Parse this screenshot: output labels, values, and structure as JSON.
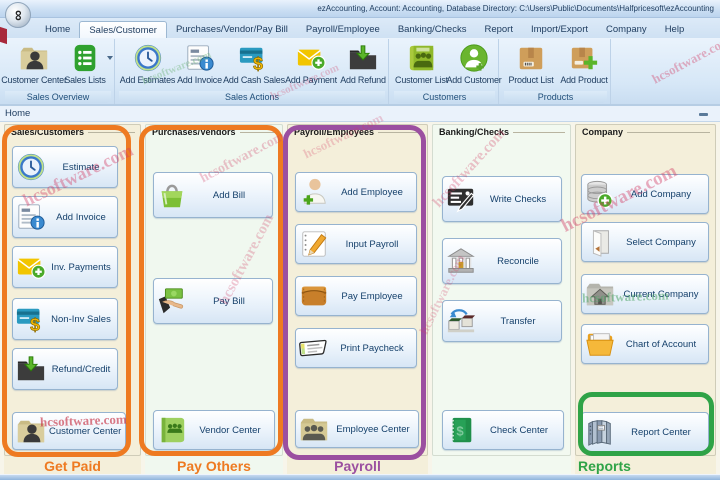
{
  "window": {
    "title": "ezAccounting, Account: Accounting, Database Directory: C:\\Users\\Public\\Documents\\Halfpricesoft\\ezAccounting"
  },
  "menu": {
    "tabs": [
      {
        "label": "Home",
        "active": false
      },
      {
        "label": "Sales/Customer",
        "active": true
      },
      {
        "label": "Purchases/Vendor/Pay Bill",
        "active": false
      },
      {
        "label": "Payroll/Employee",
        "active": false
      },
      {
        "label": "Banking/Checks",
        "active": false
      },
      {
        "label": "Report",
        "active": false
      },
      {
        "label": "Import/Export",
        "active": false
      },
      {
        "label": "Company",
        "active": false
      },
      {
        "label": "Help",
        "active": false
      }
    ]
  },
  "ribbon": {
    "groups": [
      {
        "label": "Sales Overview",
        "items": [
          {
            "label": "Customer Center",
            "icon": "customer-folder-icon"
          },
          {
            "label": "Sales Lists",
            "icon": "sales-lists-icon",
            "has_dropdown": true
          }
        ]
      },
      {
        "label": "Sales Actions",
        "items": [
          {
            "label": "Add Estimates",
            "icon": "clock-icon"
          },
          {
            "label": "Add Invoice",
            "icon": "invoice-icon"
          },
          {
            "label": "Add Cash Sales",
            "icon": "credit-card-dollar-icon"
          },
          {
            "label": "Add Payment",
            "icon": "envelope-plus-icon"
          },
          {
            "label": "Add Refund",
            "icon": "folder-refund-icon"
          }
        ]
      },
      {
        "label": "Customers",
        "items": [
          {
            "label": "Customer List",
            "icon": "people-list-icon"
          },
          {
            "label": "Add Customer",
            "icon": "person-plus-circle-icon"
          }
        ]
      },
      {
        "label": "Products",
        "items": [
          {
            "label": "Product List",
            "icon": "product-box-icon"
          },
          {
            "label": "Add Product",
            "icon": "product-box-plus-icon"
          }
        ]
      }
    ]
  },
  "view_tab": {
    "label": "Home"
  },
  "main": {
    "columns": [
      {
        "header": "Sales/Customers",
        "footer": "Get Paid",
        "highlight_color": "#EE7A21",
        "buttons": [
          {
            "label": "Estimate",
            "icon": "clock-icon"
          },
          {
            "label": "Add Invoice",
            "icon": "invoice-icon"
          },
          {
            "label": "Inv. Payments",
            "icon": "envelope-plus-icon"
          },
          {
            "label": "Non-Inv Sales",
            "icon": "credit-card-dollar-icon"
          },
          {
            "label": "Refund/Credit",
            "icon": "folder-refund-icon"
          },
          {
            "label": "Customer Center",
            "icon": "customer-folder-icon"
          }
        ]
      },
      {
        "header": "Purchases/Vendors",
        "footer": "Pay Others",
        "highlight_color": "#EE7A21",
        "buttons": [
          {
            "label": "Add Bill",
            "icon": "shopping-bag-icon"
          },
          {
            "label": "Pay Bill",
            "icon": "hand-money-icon"
          },
          {
            "label": "Vendor Center",
            "icon": "vendor-book-icon"
          }
        ]
      },
      {
        "header": "Payroll/Employees",
        "footer": "Payroll",
        "highlight_color": "#9B4FA0",
        "buttons": [
          {
            "label": "Add Employee",
            "icon": "employee-plus-icon"
          },
          {
            "label": "Input Payroll",
            "icon": "notepad-pencil-icon"
          },
          {
            "label": "Pay Employee",
            "icon": "wallet-icon"
          },
          {
            "label": "Print Paycheck",
            "icon": "paycheck-icon"
          },
          {
            "label": "Employee Center",
            "icon": "employees-folder-icon"
          }
        ]
      },
      {
        "header": "Banking/Checks",
        "footer": "",
        "buttons": [
          {
            "label": "Write Checks",
            "icon": "check-pen-icon"
          },
          {
            "label": "Reconcile",
            "icon": "bank-icon"
          },
          {
            "label": "Transfer",
            "icon": "transfer-boxes-icon"
          },
          {
            "label": "Check Center",
            "icon": "check-register-icon"
          }
        ]
      },
      {
        "header": "Company",
        "footer": "Reports",
        "highlight_color": "#2FA347",
        "buttons": [
          {
            "label": "Add Company",
            "icon": "database-plus-icon"
          },
          {
            "label": "Select Company",
            "icon": "open-door-icon"
          },
          {
            "label": "Current Company",
            "icon": "folder-home-icon"
          },
          {
            "label": "Chart of Account",
            "icon": "folder-documents-icon"
          },
          {
            "label": "Report Center",
            "icon": "binders-icon"
          }
        ]
      }
    ]
  },
  "watermark": {
    "text": "hcsoftware.com"
  },
  "icons": {
    "logo_glyph": "∞"
  },
  "colors": {
    "accent_orange": "#EE7A21",
    "accent_purple": "#9B4FA0",
    "accent_green": "#2FA347",
    "watermark_pink": "rgba(225,70,110,0.38)",
    "watermark_green": "rgba(90,170,110,0.45)"
  }
}
